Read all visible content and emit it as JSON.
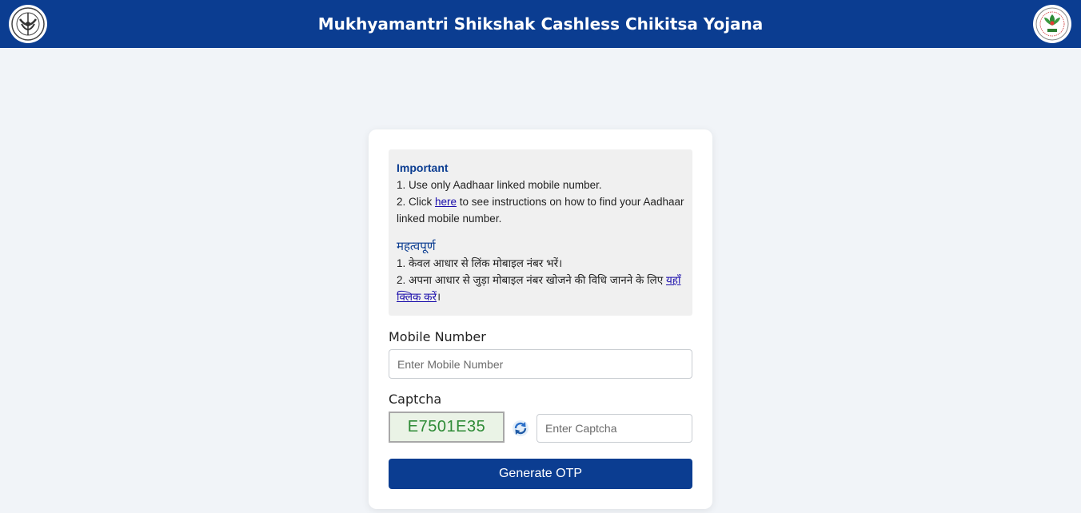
{
  "header": {
    "title": "Mukhyamantri Shikshak Cashless Chikitsa Yojana",
    "left_logo": "uttar-pradesh-emblem",
    "right_logo": "pmjay-logo"
  },
  "notice": {
    "heading_en": "Important",
    "line1_en": "1. Use only Aadhaar linked mobile number.",
    "line2_en_pre": "2. Click ",
    "line2_en_link": "here",
    "line2_en_post": " to see instructions on how to find your Aadhaar linked mobile number.",
    "heading_hi": "महत्वपूर्ण",
    "line1_hi": "1. केवल आधार से लिंक मोबाइल नंबर भरें।",
    "line2_hi_pre": "2. अपना आधार से जुड़ा मोबाइल नंबर खोजने की विधि जानने के लिए ",
    "line2_hi_link": "यहाँ क्लिक करें",
    "line2_hi_post": "।"
  },
  "form": {
    "mobile_label": "Mobile Number",
    "mobile_placeholder": "Enter Mobile Number",
    "captcha_label": "Captcha",
    "captcha_code": "E7501E35",
    "captcha_placeholder": "Enter Captcha",
    "refresh_icon": "refresh-icon",
    "submit_label": "Generate OTP"
  },
  "colors": {
    "primary": "#0b3d91",
    "background": "#f1f4f8",
    "captcha_text": "#2e8b36"
  }
}
